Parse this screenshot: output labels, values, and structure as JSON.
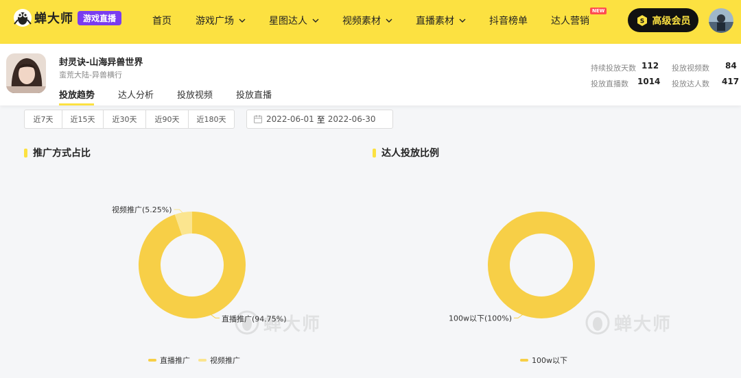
{
  "brand": {
    "name": "蝉大师",
    "badge": "游戏直播"
  },
  "nav": {
    "items": [
      {
        "label": "首页",
        "has_dropdown": false
      },
      {
        "label": "游戏广场",
        "has_dropdown": true
      },
      {
        "label": "星图达人",
        "has_dropdown": true
      },
      {
        "label": "视频素材",
        "has_dropdown": true
      },
      {
        "label": "直播素材",
        "has_dropdown": true
      },
      {
        "label": "抖音榜单",
        "has_dropdown": false
      },
      {
        "label": "达人营销",
        "has_dropdown": false
      }
    ],
    "new_tag": "NEW",
    "vip_button": "高级会员"
  },
  "game": {
    "name": "封灵诀-山海异兽世界",
    "subtitle": "蛮荒大陆-异兽横行",
    "icon": "game-avatar-icon"
  },
  "tabs": [
    "投放趋势",
    "达人分析",
    "投放视频",
    "投放直播"
  ],
  "active_tab": 0,
  "stats": [
    {
      "label": "持续投放天数",
      "value": "112"
    },
    {
      "label": "投放视频数",
      "value": "84"
    },
    {
      "label": "投放直播数",
      "value": "1014"
    },
    {
      "label": "投放达人数",
      "value": "417"
    }
  ],
  "filters": {
    "ranges": [
      "近7天",
      "近15天",
      "近30天",
      "近90天",
      "近180天"
    ],
    "date_start": "2022-06-01",
    "date_sep": "至",
    "date_end": "2022-06-30"
  },
  "sections": {
    "promo_title": "推广方式占比",
    "talent_title": "达人投放比例"
  },
  "watermark": "蝉大师",
  "colors": {
    "accent": "#fce141",
    "live": "#f7cf47",
    "video": "#fbe58f",
    "vip_bg": "#111111",
    "badge": "#7a3cf0"
  },
  "chart_data": [
    {
      "type": "pie",
      "title": "推广方式占比",
      "categories": [
        "直播推广",
        "视频推广"
      ],
      "values": [
        94.75,
        5.25
      ],
      "labels": [
        "直播推广(94.75%)",
        "视频推广(5.25%)"
      ],
      "legend": "bottom"
    },
    {
      "type": "pie",
      "title": "达人投放比例",
      "categories": [
        "100w以下"
      ],
      "values": [
        100
      ],
      "labels": [
        "100w以下(100%)"
      ],
      "legend": "bottom"
    }
  ]
}
